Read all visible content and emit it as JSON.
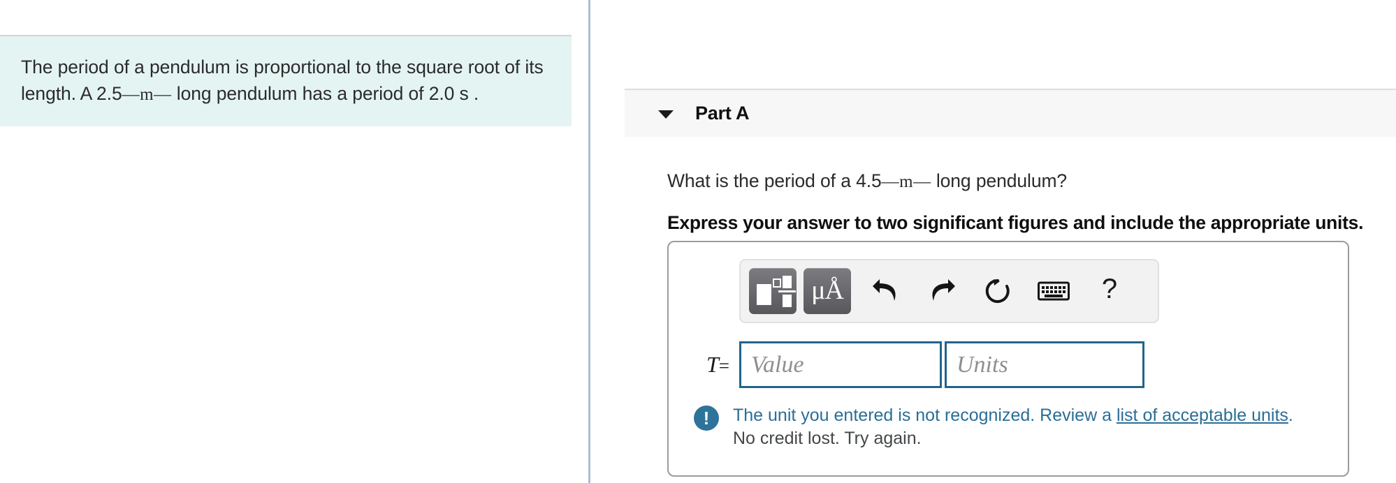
{
  "left_pane": {
    "problem_statement": {
      "line1_pre": "The period of a pendulum is proportional to the square root of its length. A ",
      "value1": "2.5",
      "unit1": "—m—",
      "mid": " long pendulum has a period of ",
      "value2": "2.0 s",
      "suffix": " ."
    }
  },
  "right_pane": {
    "part_header": {
      "caret_icon": "caret-down-icon",
      "label": "Part A"
    },
    "question": {
      "text_pre": "What is the period of a ",
      "value": "4.5",
      "unit": "—m—",
      "text_post": " long pendulum?",
      "instruction": "Express your answer to two significant figures and include the appropriate units."
    },
    "toolbar": {
      "buttons": [
        {
          "name": "math-template-button",
          "icon": "math-template-icon",
          "label": ""
        },
        {
          "name": "units-button",
          "icon": "micro-angstrom-icon",
          "label": "μÅ"
        },
        {
          "name": "undo-button",
          "icon": "undo-arrow-icon",
          "label": ""
        },
        {
          "name": "redo-button",
          "icon": "redo-arrow-icon",
          "label": ""
        },
        {
          "name": "reset-button",
          "icon": "reset-circular-arrow-icon",
          "label": ""
        },
        {
          "name": "keyboard-button",
          "icon": "keyboard-icon",
          "label": ""
        },
        {
          "name": "help-button",
          "icon": "question-mark-icon",
          "label": "?"
        }
      ]
    },
    "answer": {
      "variable_symbol": "T",
      "equals_sign": "=",
      "value_placeholder": "Value",
      "units_placeholder": "Units",
      "value_current": "",
      "units_current": ""
    },
    "feedback": {
      "icon": "error-exclamation-icon",
      "message_part1": "The unit you entered is not recognized. Review a ",
      "link_text": "list of acceptable units",
      "message_part2": ".",
      "message_line2": "No credit lost. Try again."
    }
  },
  "colors": {
    "problem_background": "#e4f4f2",
    "divider": "#aebdd2",
    "part_header_background": "#f7f7f7",
    "input_border": "#22638e",
    "feedback_accent": "#2a6e96",
    "error_icon": "#2e7399",
    "toolbar_button_dark": "#58585c"
  }
}
